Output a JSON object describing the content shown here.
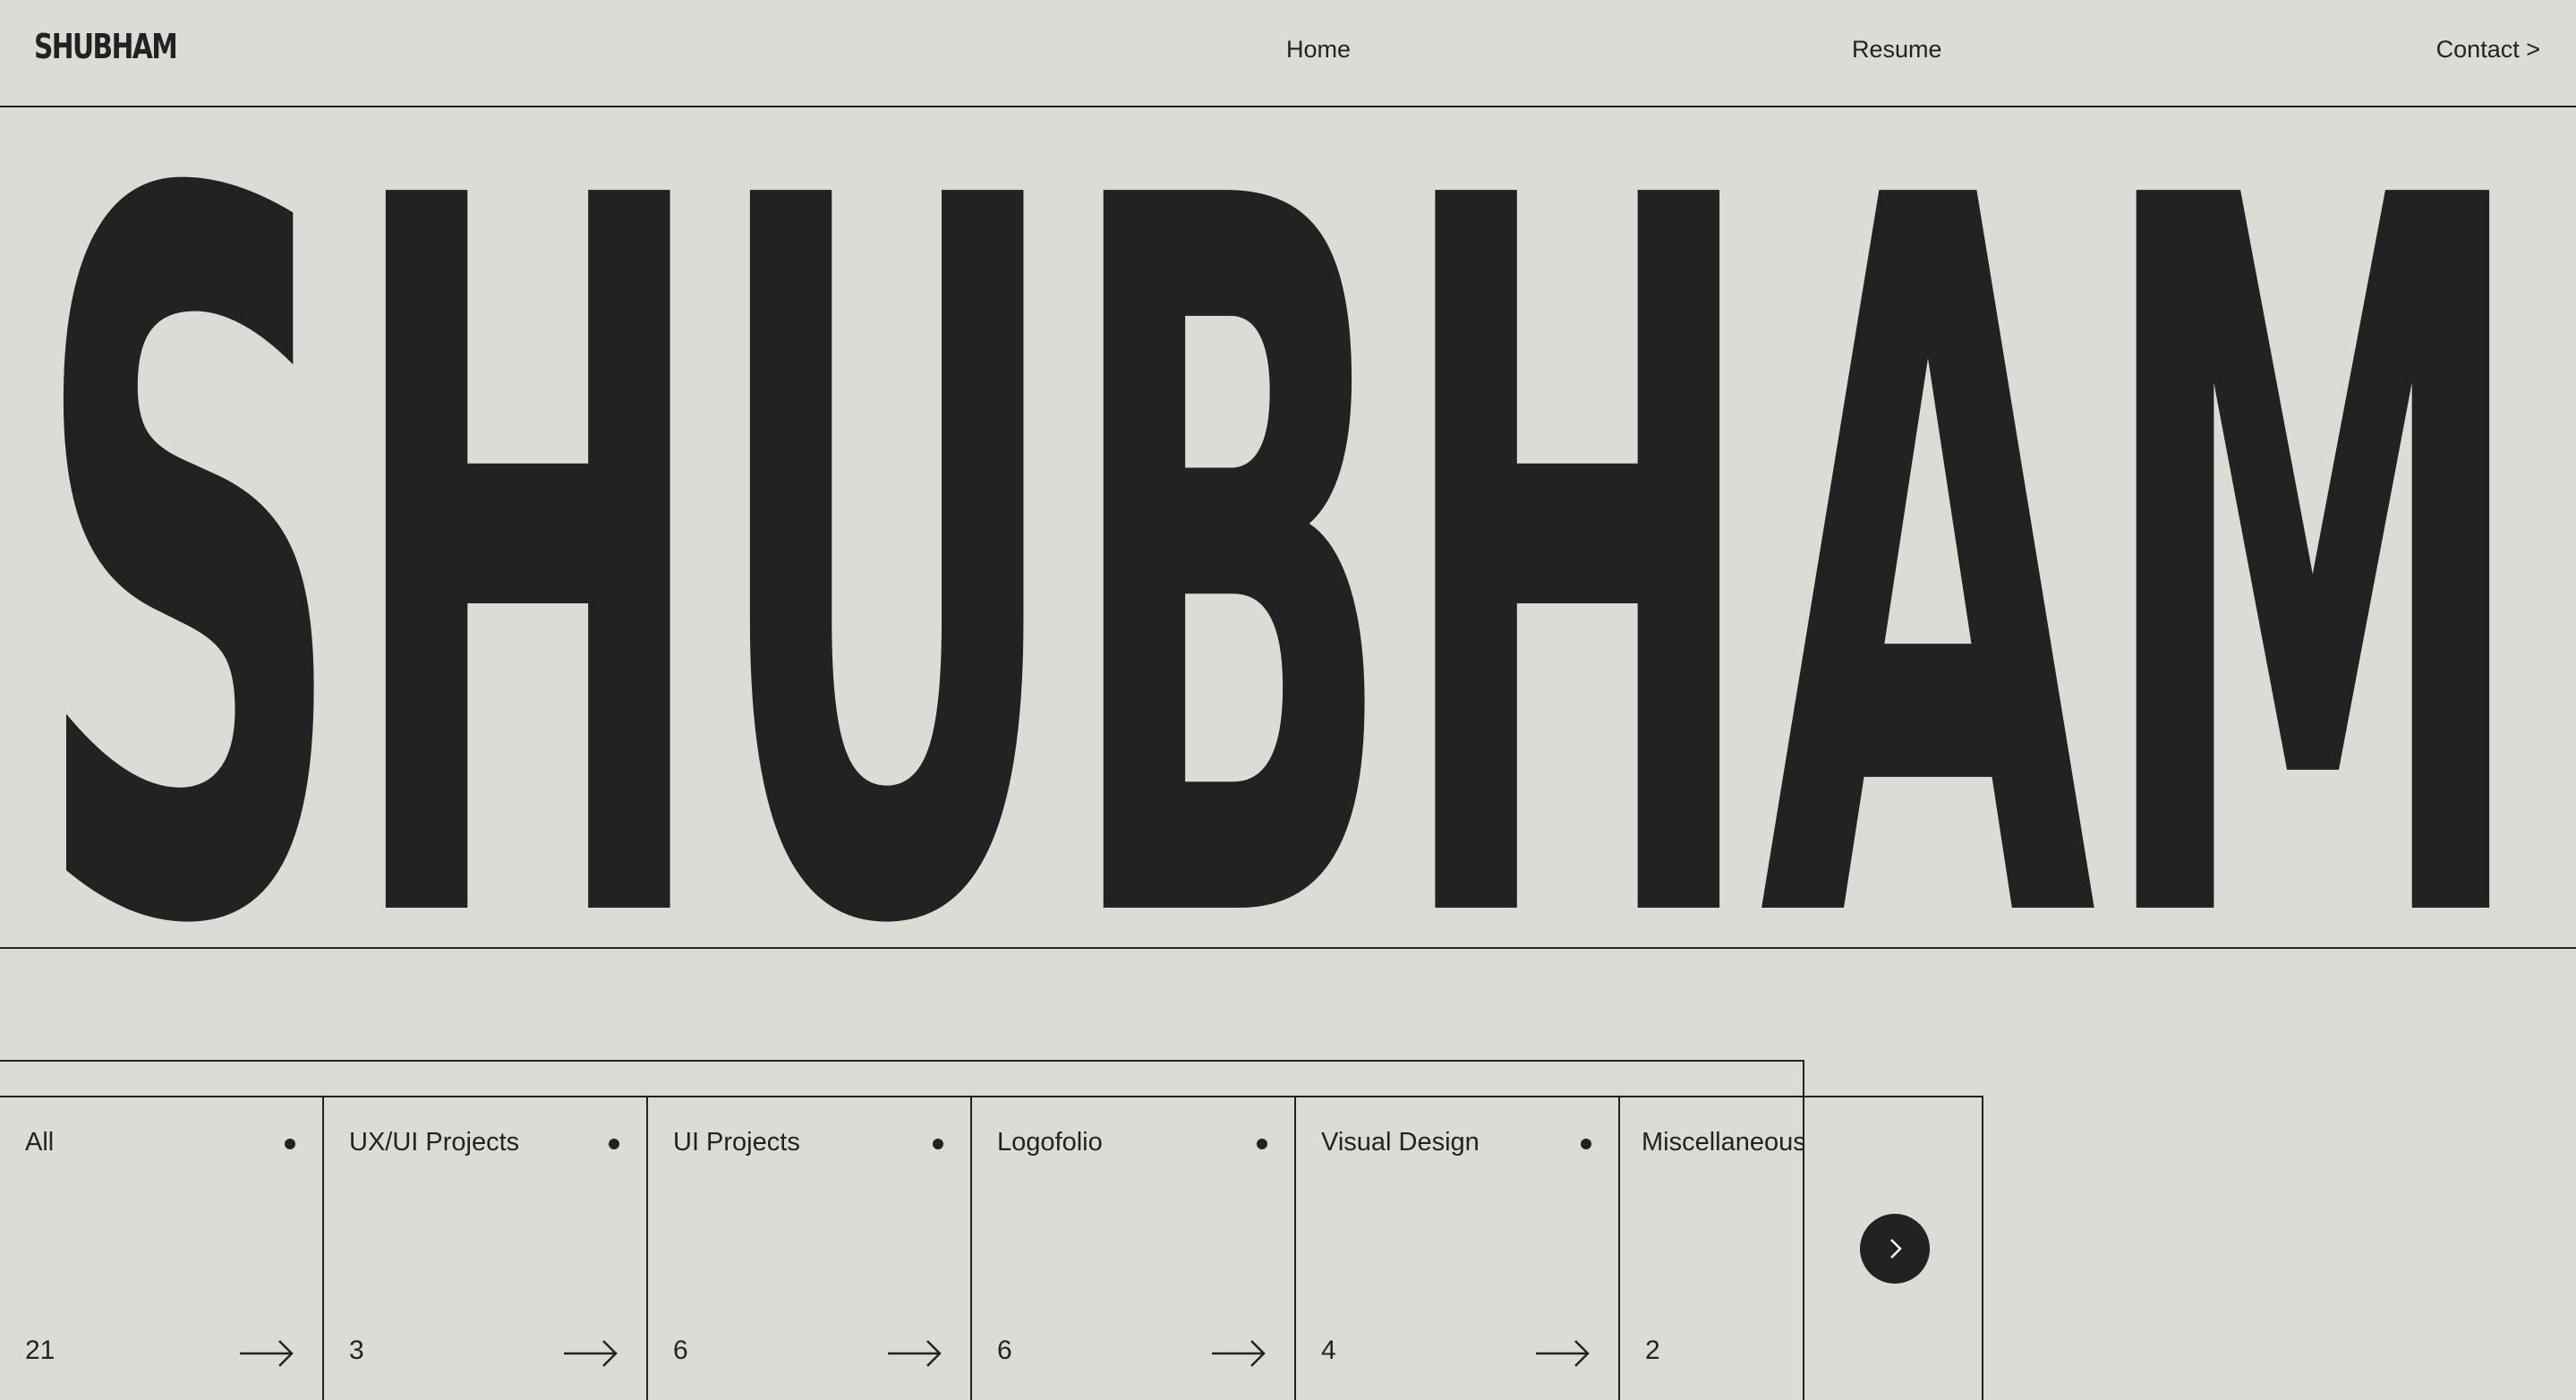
{
  "header": {
    "logo": "SHUBHAM",
    "nav": {
      "home": "Home",
      "resume": "Resume",
      "contact": "Contact >"
    }
  },
  "hero": {
    "title": "SHUBHAM"
  },
  "categories": [
    {
      "label": "All",
      "count": "21"
    },
    {
      "label": "UX/UI Projects",
      "count": "3"
    },
    {
      "label": "UI Projects",
      "count": "6"
    },
    {
      "label": "Logofolio",
      "count": "6"
    },
    {
      "label": "Visual Design",
      "count": "4"
    },
    {
      "label": "Miscellaneous",
      "count": "2"
    }
  ],
  "icons": {
    "arrow": "arrow-right-icon",
    "next": "chevron-right-icon",
    "dot": "bullet-dot-icon"
  },
  "colors": {
    "background": "#dcdcd7",
    "ink": "#222222"
  }
}
